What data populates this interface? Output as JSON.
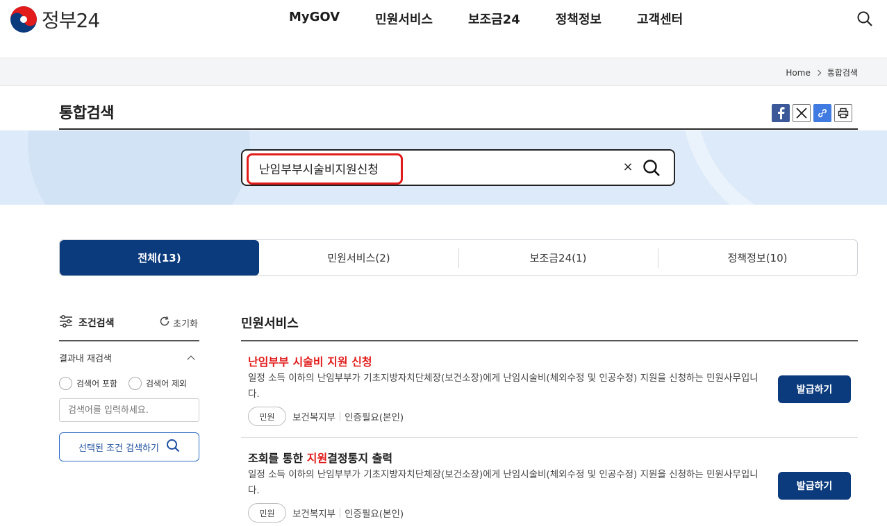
{
  "header": {
    "logo_text": "정부24",
    "nav": [
      "MyGOV",
      "민원서비스",
      "보조금24",
      "정책정보",
      "고객센터"
    ]
  },
  "breadcrumb": {
    "home": "Home",
    "current": "통합검색"
  },
  "page": {
    "title": "통합검색"
  },
  "search": {
    "query": "난임부부시술비지원신청",
    "clear_symbol": "×"
  },
  "tabs": [
    {
      "label": "전체(13)",
      "active": true
    },
    {
      "label": "민원서비스(2)",
      "active": false
    },
    {
      "label": "보조금24(1)",
      "active": false
    },
    {
      "label": "정책정보(10)",
      "active": false
    }
  ],
  "filter": {
    "title": "조건검색",
    "reset": "초기화",
    "recheck": "결과내 재검색",
    "include": "검색어 포함",
    "exclude": "검색어 제외",
    "keyword_placeholder": "검색어를 입력하세요.",
    "search_button": "선택된 조건 검색하기"
  },
  "results": {
    "section_title": "민원서비스",
    "items": [
      {
        "title_pre": "",
        "title_hl": "난임부부 시술비 지원 신청",
        "title_post": "",
        "desc": "일정 소득 이하의 난임부부가 기초지방자치단체장(보건소장)에게 난임시술비(체외수정 및 인공수정) 지원을 신청하는 민원사무입니다.",
        "chip": "민원",
        "agency": "보건복지부",
        "auth": "인증필요(본인)",
        "button": "발급하기"
      },
      {
        "title_pre": "조회를 통한 ",
        "title_hl": "지원",
        "title_post": "결정통지 출력",
        "desc": "일정 소득 이하의 난임부부가 기초지방자치단체장(보건소장)에게 난임시술비(체외수정 및 인공수정) 지원을 신청하는 민원사무입니다.",
        "chip": "민원",
        "agency": "보건복지부",
        "auth": "인증필요(본인)",
        "button": "발급하기"
      }
    ]
  },
  "colors": {
    "primary": "#0b3a7d",
    "highlight": "#e21b1b",
    "band": "#ddeaf9"
  }
}
